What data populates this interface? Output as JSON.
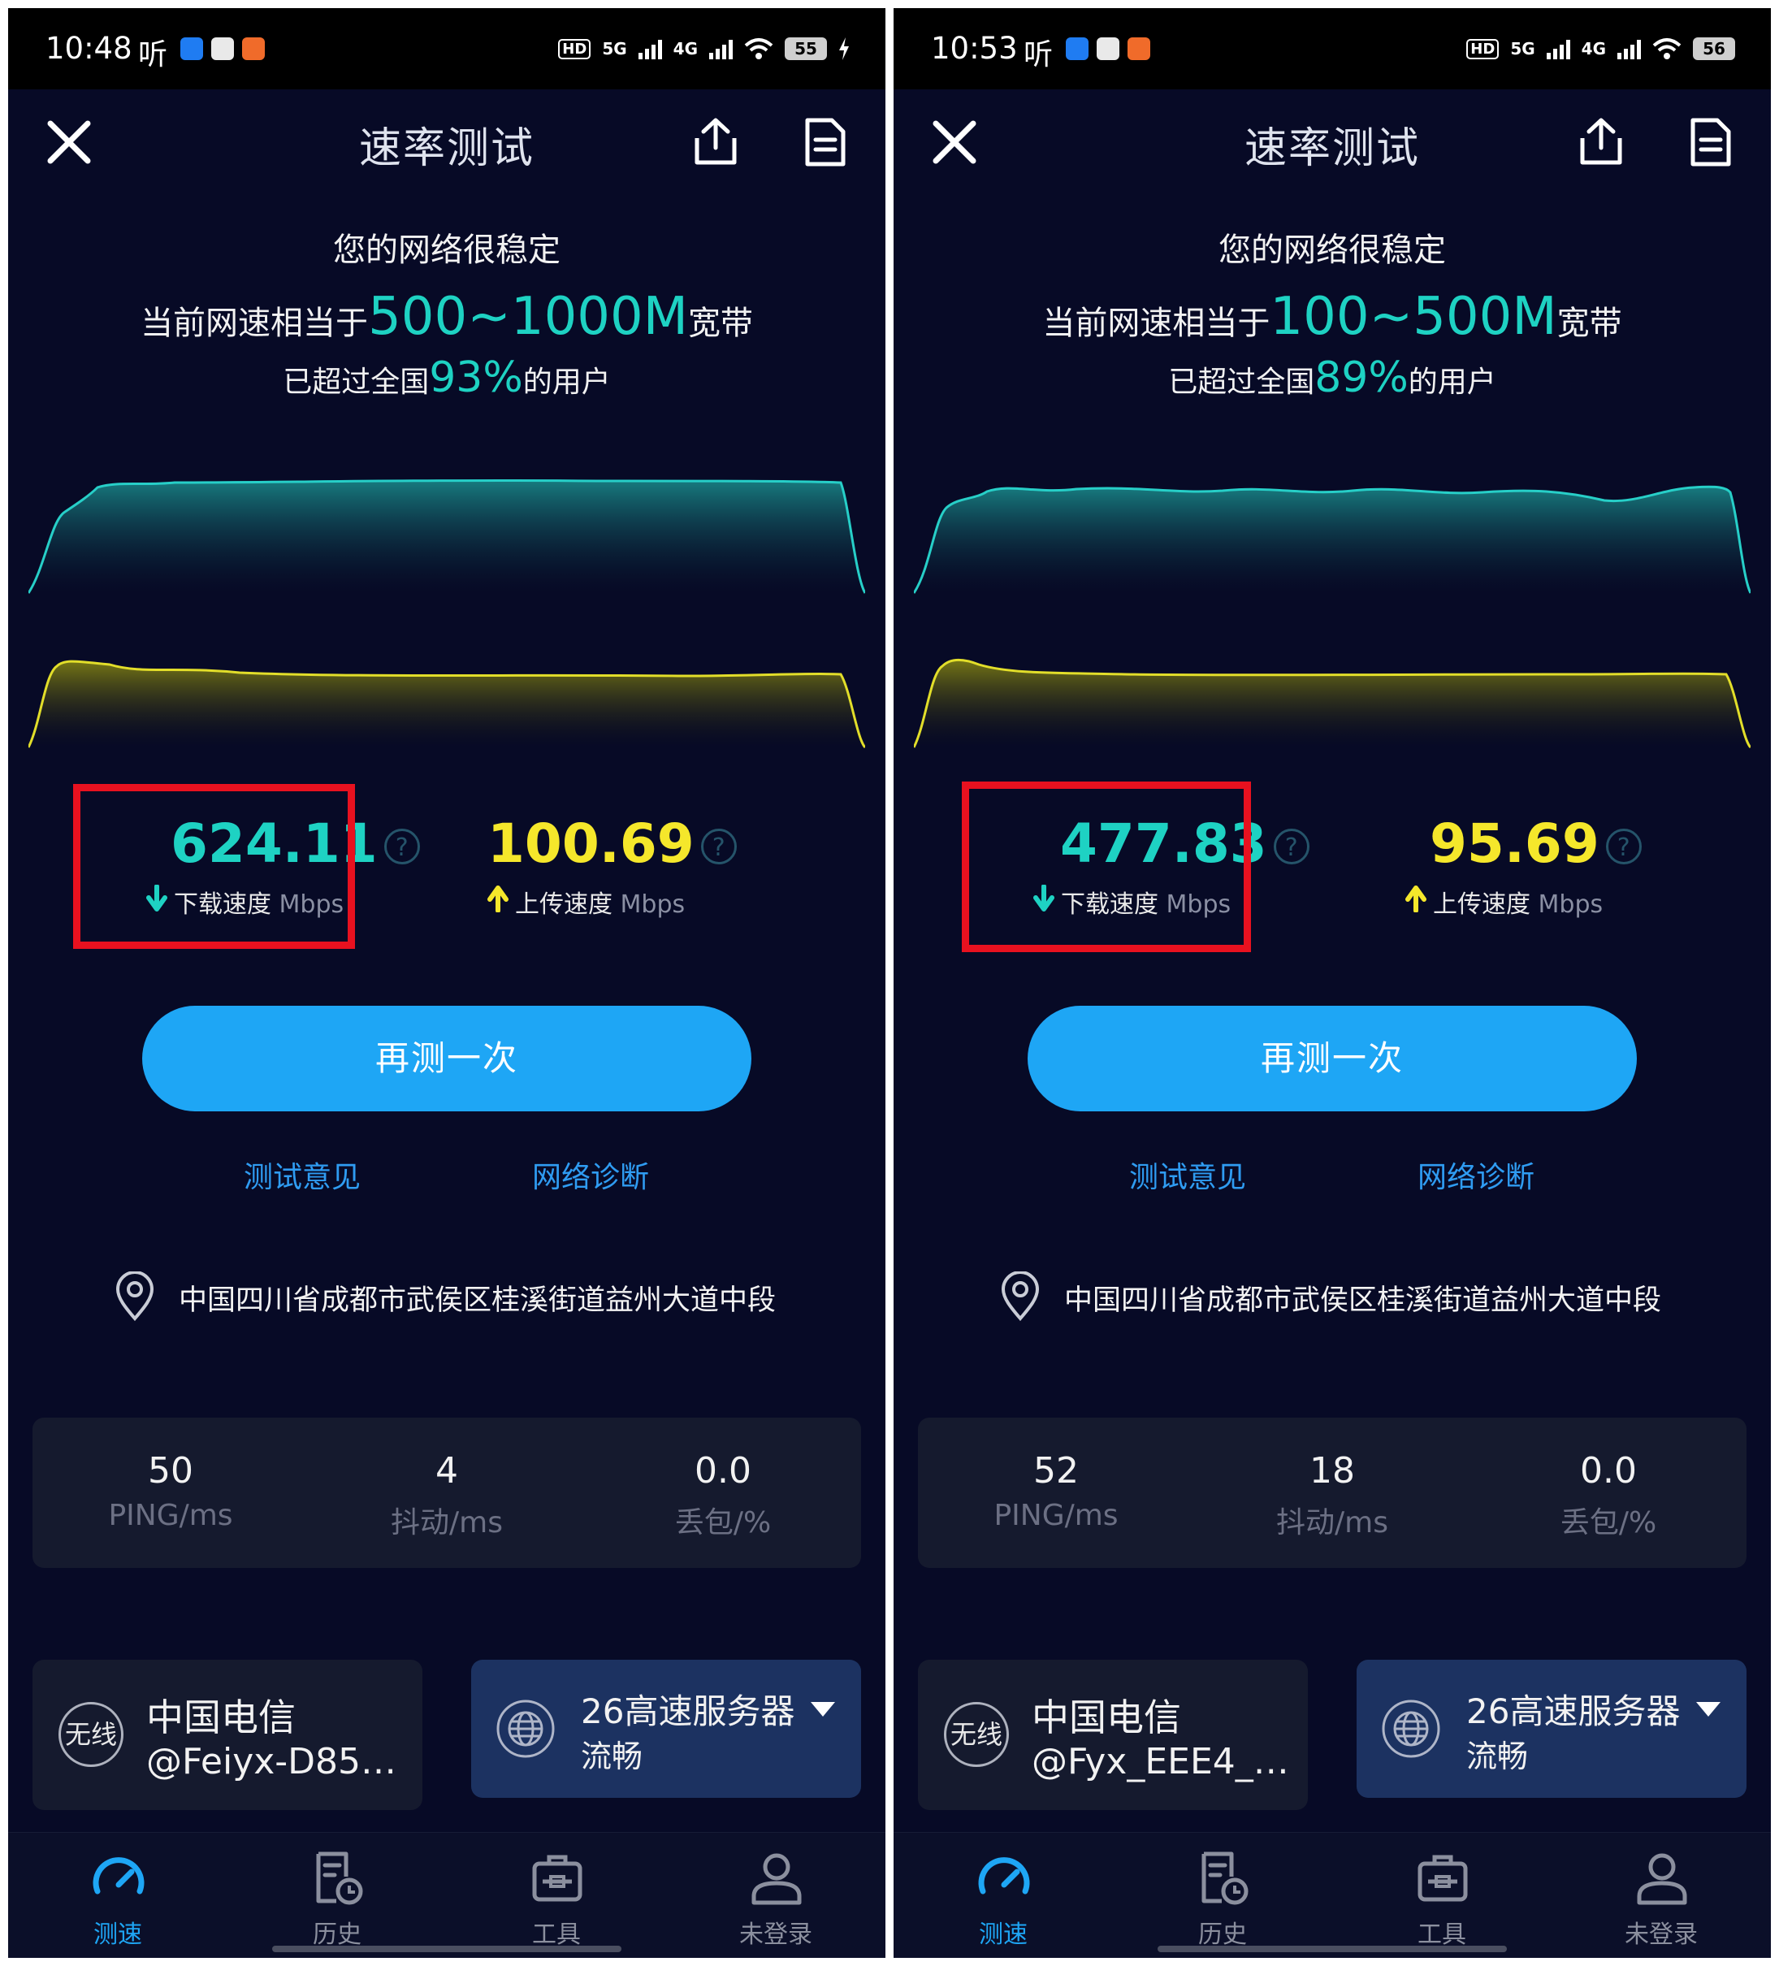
{
  "screens": [
    {
      "statusbar": {
        "time": "10:48",
        "ting": "听",
        "net_5g": "5G",
        "net_4g": "4G",
        "hd": "HD",
        "battery": "55"
      },
      "header": {
        "title": "速率测试"
      },
      "summary": {
        "stable_text": "您的网络很稳定",
        "band_prefix": "当前网速相当于",
        "band_value": "500~1000M",
        "band_suffix": "宽带",
        "pct_prefix": "已超过全国",
        "pct_value": "93%",
        "pct_suffix": "的用户"
      },
      "download": {
        "value": "624.11",
        "label": "下载速度",
        "unit": "Mbps"
      },
      "upload": {
        "value": "100.69",
        "label": "上传速度",
        "unit": "Mbps"
      },
      "help_icon": "?",
      "retest_label": "再测一次",
      "links": {
        "feedback": "测试意见",
        "diagnose": "网络诊断"
      },
      "location": "中国四川省成都市武侯区桂溪街道益州大道中段",
      "metrics": [
        {
          "value": "50",
          "label": "PING/ms"
        },
        {
          "value": "4",
          "label": "抖动/ms"
        },
        {
          "value": "0.0",
          "label": "丢包/%"
        }
      ],
      "isp": {
        "badge": "无线",
        "name": "中国电信",
        "ssid": "@Feiyx-D85…"
      },
      "server": {
        "name": "26高速服务器",
        "status": "流畅"
      },
      "tabs": [
        {
          "label": "测速",
          "icon": "speedometer-icon"
        },
        {
          "label": "历史",
          "icon": "history-icon"
        },
        {
          "label": "工具",
          "icon": "toolbox-icon"
        },
        {
          "label": "未登录",
          "icon": "user-icon"
        }
      ]
    },
    {
      "statusbar": {
        "time": "10:53",
        "ting": "听",
        "net_5g": "5G",
        "net_4g": "4G",
        "hd": "HD",
        "battery": "56"
      },
      "header": {
        "title": "速率测试"
      },
      "summary": {
        "stable_text": "您的网络很稳定",
        "band_prefix": "当前网速相当于",
        "band_value": "100~500M",
        "band_suffix": "宽带",
        "pct_prefix": "已超过全国",
        "pct_value": "89%",
        "pct_suffix": "的用户"
      },
      "download": {
        "value": "477.83",
        "label": "下载速度",
        "unit": "Mbps"
      },
      "upload": {
        "value": "95.69",
        "label": "上传速度",
        "unit": "Mbps"
      },
      "help_icon": "?",
      "retest_label": "再测一次",
      "links": {
        "feedback": "测试意见",
        "diagnose": "网络诊断"
      },
      "location": "中国四川省成都市武侯区桂溪街道益州大道中段",
      "metrics": [
        {
          "value": "52",
          "label": "PING/ms"
        },
        {
          "value": "18",
          "label": "抖动/ms"
        },
        {
          "value": "0.0",
          "label": "丢包/%"
        }
      ],
      "isp": {
        "badge": "无线",
        "name": "中国电信",
        "ssid": "@Fyx_EEE4_…"
      },
      "server": {
        "name": "26高速服务器",
        "status": "流畅"
      },
      "tabs": [
        {
          "label": "测速",
          "icon": "speedometer-icon"
        },
        {
          "label": "历史",
          "icon": "history-icon"
        },
        {
          "label": "工具",
          "icon": "toolbox-icon"
        },
        {
          "label": "未登录",
          "icon": "user-icon"
        }
      ]
    }
  ],
  "colors": {
    "background": "#070a26",
    "download_accent": "#1ed2c3",
    "upload_accent": "#f5e72b",
    "button": "#1ea6f5",
    "link": "#2f9cf2",
    "highlight_box": "#e8111f"
  }
}
